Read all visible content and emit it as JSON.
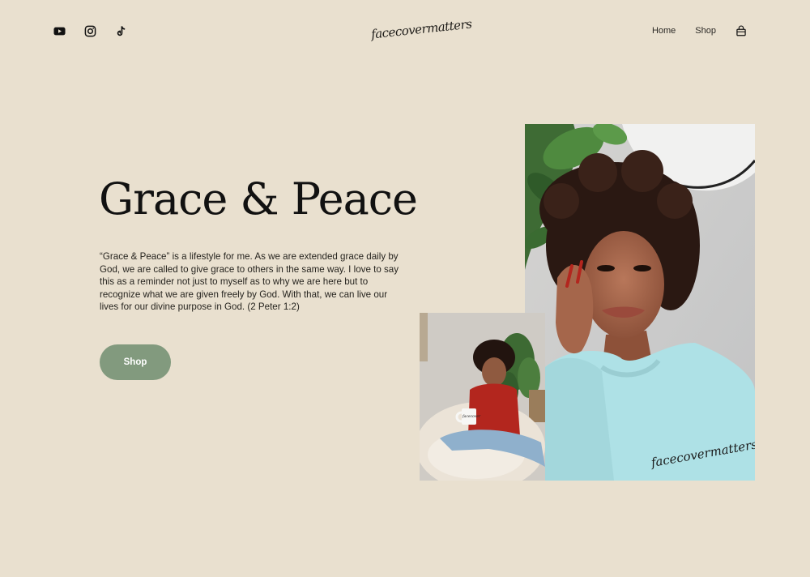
{
  "header": {
    "social": [
      {
        "name": "youtube-icon"
      },
      {
        "name": "instagram-icon"
      },
      {
        "name": "tiktok-icon"
      }
    ],
    "logo": "facecovermatters",
    "nav": {
      "home": "Home",
      "shop": "Shop",
      "cart_icon": "shopping-bag-icon"
    }
  },
  "hero": {
    "title": "Grace & Peace",
    "description": "“Grace & Peace” is a lifestyle for me. As we are extended grace daily by God, we are called to give grace to others in the same way. I love to say this as a reminder not just to myself as to why we are here but to recognize what we are given freely by God. With that, we can live our lives for our divine purpose in God. (2 Peter 1:2)",
    "button": "Shop"
  },
  "photos": {
    "main_shirt_print": "facecovermatters",
    "small_mug_print": "facecover"
  },
  "colors": {
    "background": "#e9e0cf",
    "button": "#829a7e",
    "sweatshirt": "#aee1e6"
  }
}
